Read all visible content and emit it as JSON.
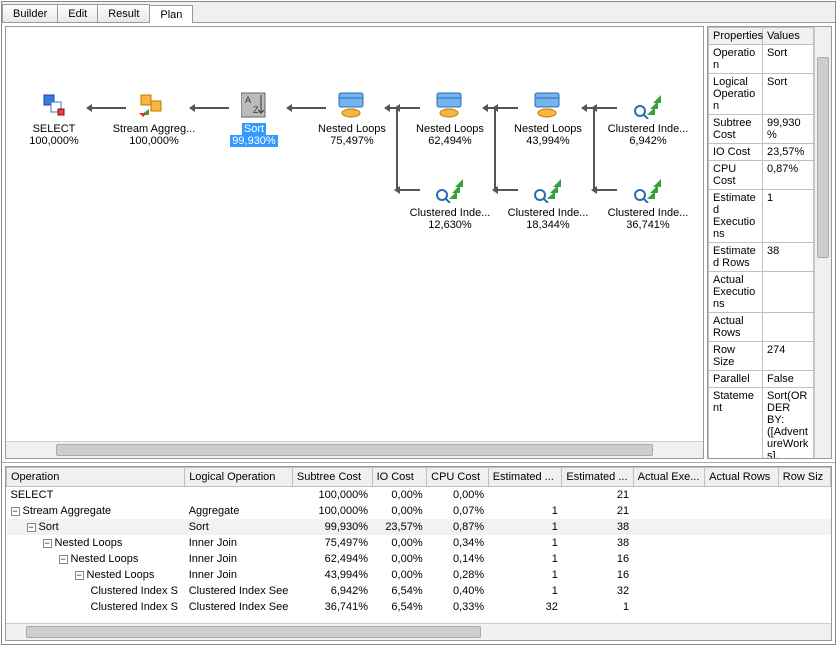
{
  "tabs": [
    "Builder",
    "Edit",
    "Result",
    "Plan"
  ],
  "active_tab": 3,
  "plan_nodes": {
    "select": {
      "label": "SELECT",
      "pct": "100,000%"
    },
    "streamagg": {
      "label": "Stream Aggreg...",
      "pct": "100,000%"
    },
    "sort": {
      "label": "Sort",
      "pct": "99,930%"
    },
    "nl1": {
      "label": "Nested Loops",
      "pct": "75,497%"
    },
    "nl2": {
      "label": "Nested Loops",
      "pct": "62,494%"
    },
    "nl3": {
      "label": "Nested Loops",
      "pct": "43,994%"
    },
    "ci1": {
      "label": "Clustered Inde...",
      "pct": "6,942%"
    },
    "ci2": {
      "label": "Clustered Inde...",
      "pct": "12,630%"
    },
    "ci3": {
      "label": "Clustered Inde...",
      "pct": "18,344%"
    },
    "ci4": {
      "label": "Clustered Inde...",
      "pct": "36,741%"
    }
  },
  "props_headers": [
    "Properties",
    "Values"
  ],
  "props": [
    [
      "Operation",
      "Sort"
    ],
    [
      "Logical Operation",
      "Sort"
    ],
    [
      "Subtree Cost",
      "99,930%"
    ],
    [
      "IO Cost",
      "23,57%"
    ],
    [
      "CPU Cost",
      "0,87%"
    ],
    [
      "Estimated Executions",
      "1"
    ],
    [
      "Estimated Rows",
      "38"
    ],
    [
      "Actual Executions",
      ""
    ],
    [
      "Actual Rows",
      ""
    ],
    [
      "Row Size",
      "274"
    ],
    [
      "Parallel",
      "False"
    ],
    [
      "Statement",
      "Sort(ORDER BY:([AdventureWorks].[Production].[Prod"
    ]
  ],
  "grid_headers": [
    "Operation",
    "Logical Operation",
    "Subtree Cost",
    "IO Cost",
    "CPU Cost",
    "Estimated ...",
    "Estimated ...",
    "Actual Exe...",
    "Actual Rows",
    "Row Siz"
  ],
  "grid_rows": [
    {
      "indent": 0,
      "tw": "",
      "op": "SELECT",
      "log": "",
      "sub": "100,000%",
      "io": "0,00%",
      "cpu": "0,00%",
      "ee": "",
      "er": "21",
      "ae": "",
      "ar": ""
    },
    {
      "indent": 0,
      "tw": "−",
      "op": "Stream Aggregate",
      "log": "Aggregate",
      "sub": "100,000%",
      "io": "0,00%",
      "cpu": "0,07%",
      "ee": "1",
      "er": "21",
      "ae": "",
      "ar": ""
    },
    {
      "indent": 1,
      "tw": "−",
      "op": "Sort",
      "log": "Sort",
      "sub": "99,930%",
      "io": "23,57%",
      "cpu": "0,87%",
      "ee": "1",
      "er": "38",
      "ae": "",
      "ar": "",
      "sel": true
    },
    {
      "indent": 2,
      "tw": "−",
      "op": "Nested Loops",
      "log": "Inner Join",
      "sub": "75,497%",
      "io": "0,00%",
      "cpu": "0,34%",
      "ee": "1",
      "er": "38",
      "ae": "",
      "ar": ""
    },
    {
      "indent": 3,
      "tw": "−",
      "op": "Nested Loops",
      "log": "Inner Join",
      "sub": "62,494%",
      "io": "0,00%",
      "cpu": "0,14%",
      "ee": "1",
      "er": "16",
      "ae": "",
      "ar": ""
    },
    {
      "indent": 4,
      "tw": "−",
      "op": "Nested Loops",
      "log": "Inner Join",
      "sub": "43,994%",
      "io": "0,00%",
      "cpu": "0,28%",
      "ee": "1",
      "er": "16",
      "ae": "",
      "ar": ""
    },
    {
      "indent": 5,
      "tw": "",
      "op": "Clustered Index S",
      "log": "Clustered Index See",
      "sub": "6,942%",
      "io": "6,54%",
      "cpu": "0,40%",
      "ee": "1",
      "er": "32",
      "ae": "",
      "ar": ""
    },
    {
      "indent": 5,
      "tw": "",
      "op": "Clustered Index S",
      "log": "Clustered Index See",
      "sub": "36,741%",
      "io": "6,54%",
      "cpu": "0,33%",
      "ee": "32",
      "er": "1",
      "ae": "",
      "ar": ""
    }
  ]
}
